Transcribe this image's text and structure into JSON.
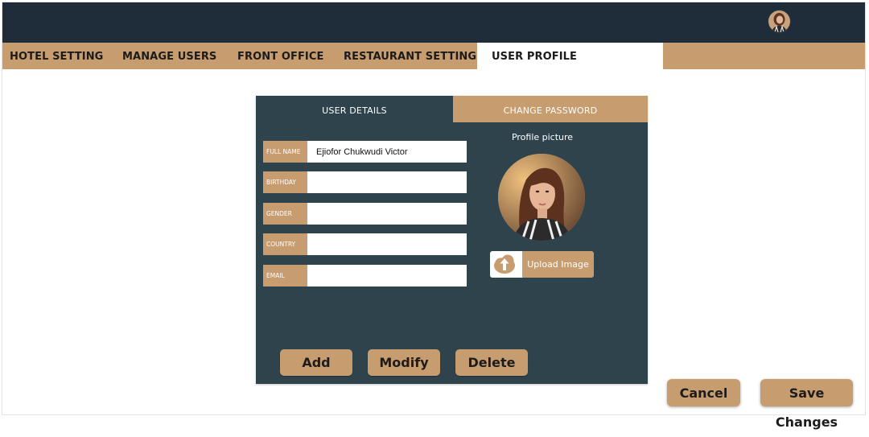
{
  "header": {
    "avatar_icon": "user-avatar-icon"
  },
  "nav": {
    "items": [
      {
        "label": "HOTEL SETTING"
      },
      {
        "label": "MANAGE USERS"
      },
      {
        "label": "FRONT OFFICE"
      },
      {
        "label": "RESTAURANT SETTING"
      },
      {
        "label": "USER PROFILE",
        "active": true
      }
    ]
  },
  "panel": {
    "tabs": [
      {
        "label": "USER DETAILS",
        "active": true
      },
      {
        "label": "CHANGE PASSWORD"
      }
    ],
    "fields": [
      {
        "label": "FULL NAME",
        "value": "Ejiofor Chukwudi Victor"
      },
      {
        "label": "BIRTHDAY",
        "value": ""
      },
      {
        "label": "GENDER",
        "value": ""
      },
      {
        "label": "COUNTRY",
        "value": ""
      },
      {
        "label": "EMAIL",
        "value": ""
      }
    ],
    "profile_title": "Profile picture",
    "upload_label": "Upload Image",
    "upload_icon": "upload-arrow-icon",
    "actions": {
      "add": "Add",
      "modify": "Modify",
      "delete": "Delete"
    }
  },
  "footer": {
    "cancel": "Cancel",
    "save": "Save Changes"
  },
  "colors": {
    "topbar": "#1f2d3a",
    "accent": "#c79c6e",
    "panel": "#2f434d"
  }
}
